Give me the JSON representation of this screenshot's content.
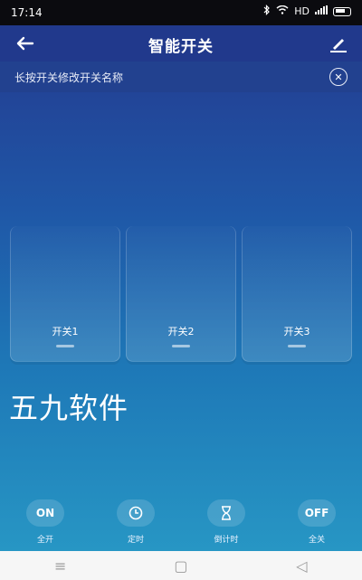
{
  "status_bar": {
    "time": "17:14",
    "hd_label": "HD"
  },
  "header": {
    "title": "智能开关"
  },
  "hint": {
    "text": "长按开关修改开关名称",
    "close_symbol": "✕"
  },
  "switches": [
    {
      "label": "开关1"
    },
    {
      "label": "开关2"
    },
    {
      "label": "开关3"
    }
  ],
  "watermark": "五九软件",
  "actions": [
    {
      "label": "全开",
      "icon_text": "ON",
      "icon": "on-icon"
    },
    {
      "label": "定时",
      "icon_text": "",
      "icon": "clock-icon"
    },
    {
      "label": "倒计时",
      "icon_text": "",
      "icon": "hourglass-icon"
    },
    {
      "label": "全关",
      "icon_text": "OFF",
      "icon": "off-icon"
    }
  ],
  "navbar": {
    "menu_symbol": "≡",
    "home_symbol": "▢",
    "back_symbol": "◁"
  },
  "colors": {
    "header_bg": "#21398c",
    "gradient_top": "#243a8f",
    "gradient_bottom": "#2796c4"
  }
}
